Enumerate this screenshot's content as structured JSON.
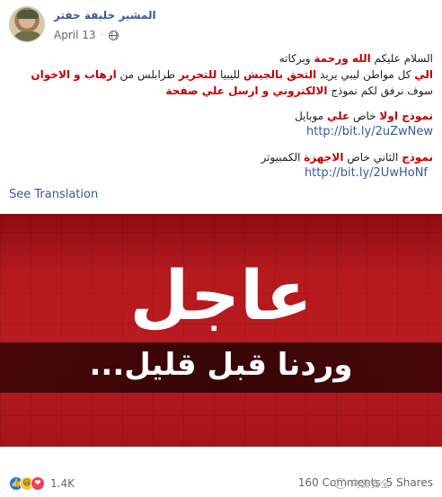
{
  "post": {
    "author": "المشير خليفة حفتر",
    "date": "April 13",
    "separator": "·",
    "privacy_icon": "globe-icon"
  },
  "content": {
    "greeting": {
      "part1": "السلام عليكم ",
      "highlight": "الله ورحمة",
      "part2": " وبركاته"
    },
    "line2": {
      "h1": "الي",
      "t1": " كل مواطن ليبي يريد ",
      "h2": "التحق بالجيش",
      "t2": " لليبيا ",
      "h3": "للتحرير",
      "t3": " طرابلس من ",
      "h4": "ارهاب و الاخوان"
    },
    "line3": {
      "t1": "سوف نرفق لكم نموذج ",
      "h1": "الالكتروني و ارسل علي صفحة"
    },
    "form1": {
      "h1": "نموذج اولا",
      "t1": " خاص ",
      "h2": "علي",
      "t2": " موبايل"
    },
    "link1": "http://bit.ly/2uZwNew",
    "form2": {
      "h1": "نموذج",
      "t1": " الثاني خاص ",
      "h2": "الاجهزة",
      "t2": " الكمبيوتر"
    },
    "link2": "http://bit.ly/2UwHoNf",
    "see_translation": "See Translation"
  },
  "image": {
    "headline": "عاجل",
    "subline": "وردنا قبل قليل..."
  },
  "footer": {
    "reaction_icons": [
      "like-icon",
      "haha-icon",
      "love-icon"
    ],
    "reaction_count": "1.4K",
    "comments": "160 Comments",
    "shares": "5 Shares",
    "watermark": "乌云安全"
  }
}
